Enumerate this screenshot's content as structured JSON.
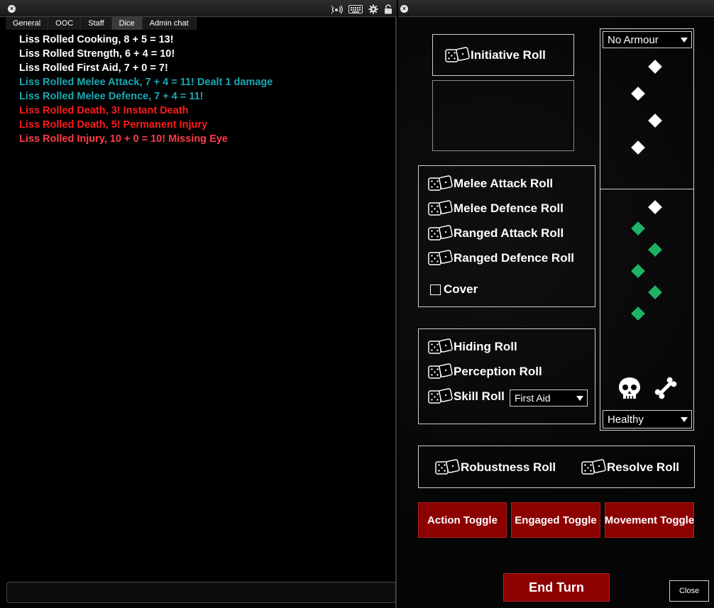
{
  "chat": {
    "tabs": [
      {
        "label": "General"
      },
      {
        "label": "OOC"
      },
      {
        "label": "Staff"
      },
      {
        "label": "Dice"
      },
      {
        "label": "Admin chat"
      }
    ],
    "active_tab": "Dice",
    "messages": [
      {
        "text": "Liss Rolled Cooking, 8 + 5 = 13!",
        "color": "#ffffff"
      },
      {
        "text": "Liss Rolled Strength, 6 + 4 = 10!",
        "color": "#ffffff"
      },
      {
        "text": "Liss Rolled First Aid, 7 + 0 = 7!",
        "color": "#ffffff"
      },
      {
        "text": "Liss Rolled Melee Attack, 7 + 4 = 11! Dealt 1 damage",
        "color": "#19a8b4"
      },
      {
        "text": "Liss Rolled Melee Defence, 7 + 4 = 11!",
        "color": "#19a8b4"
      },
      {
        "text": "Liss Rolled Death, 3! Instant Death",
        "color": "#ff1a1a"
      },
      {
        "text": "Liss Rolled Death, 5! Permanent Injury",
        "color": "#ff1a1a"
      },
      {
        "text": "Liss Rolled Injury, 10 + 0 = 10! Missing Eye",
        "color": "#ff3a4a"
      }
    ],
    "input_value": ""
  },
  "titlebar_icons": [
    "close-icon",
    "signal-icon",
    "keyboard-icon",
    "gear-icon",
    "lock-icon"
  ],
  "combat": {
    "initiative_label": "Initiative Roll",
    "armour_select": "No Armour",
    "health_select": "Healthy",
    "combat_rolls": [
      {
        "label": "Melee Attack Roll"
      },
      {
        "label": "Melee Defence Roll"
      },
      {
        "label": "Ranged Attack Roll"
      },
      {
        "label": "Ranged Defence Roll"
      }
    ],
    "cover_label": "Cover",
    "cover_checked": false,
    "skill_rolls": [
      {
        "label": "Hiding Roll"
      },
      {
        "label": "Perception Roll"
      },
      {
        "label": "Skill Roll"
      }
    ],
    "skill_select": "First Aid",
    "robustness_label": "Robustness Roll",
    "resolve_label": "Resolve Roll",
    "toggles": {
      "action": "Action Toggle",
      "engaged": "Engaged Toggle",
      "movement": "Movement Toggle"
    },
    "end_turn_label": "End Turn",
    "close_label": "Close",
    "armour_pips": [
      "white",
      "white",
      "white",
      "white"
    ],
    "health_pips": [
      "white",
      "green",
      "green",
      "green",
      "green",
      "green"
    ],
    "status_icons": [
      "skull-icon",
      "bone-icon"
    ],
    "colors": {
      "toggle_red": "#8c0000",
      "pip_green": "#1db366",
      "pip_white": "#ffffff"
    }
  }
}
